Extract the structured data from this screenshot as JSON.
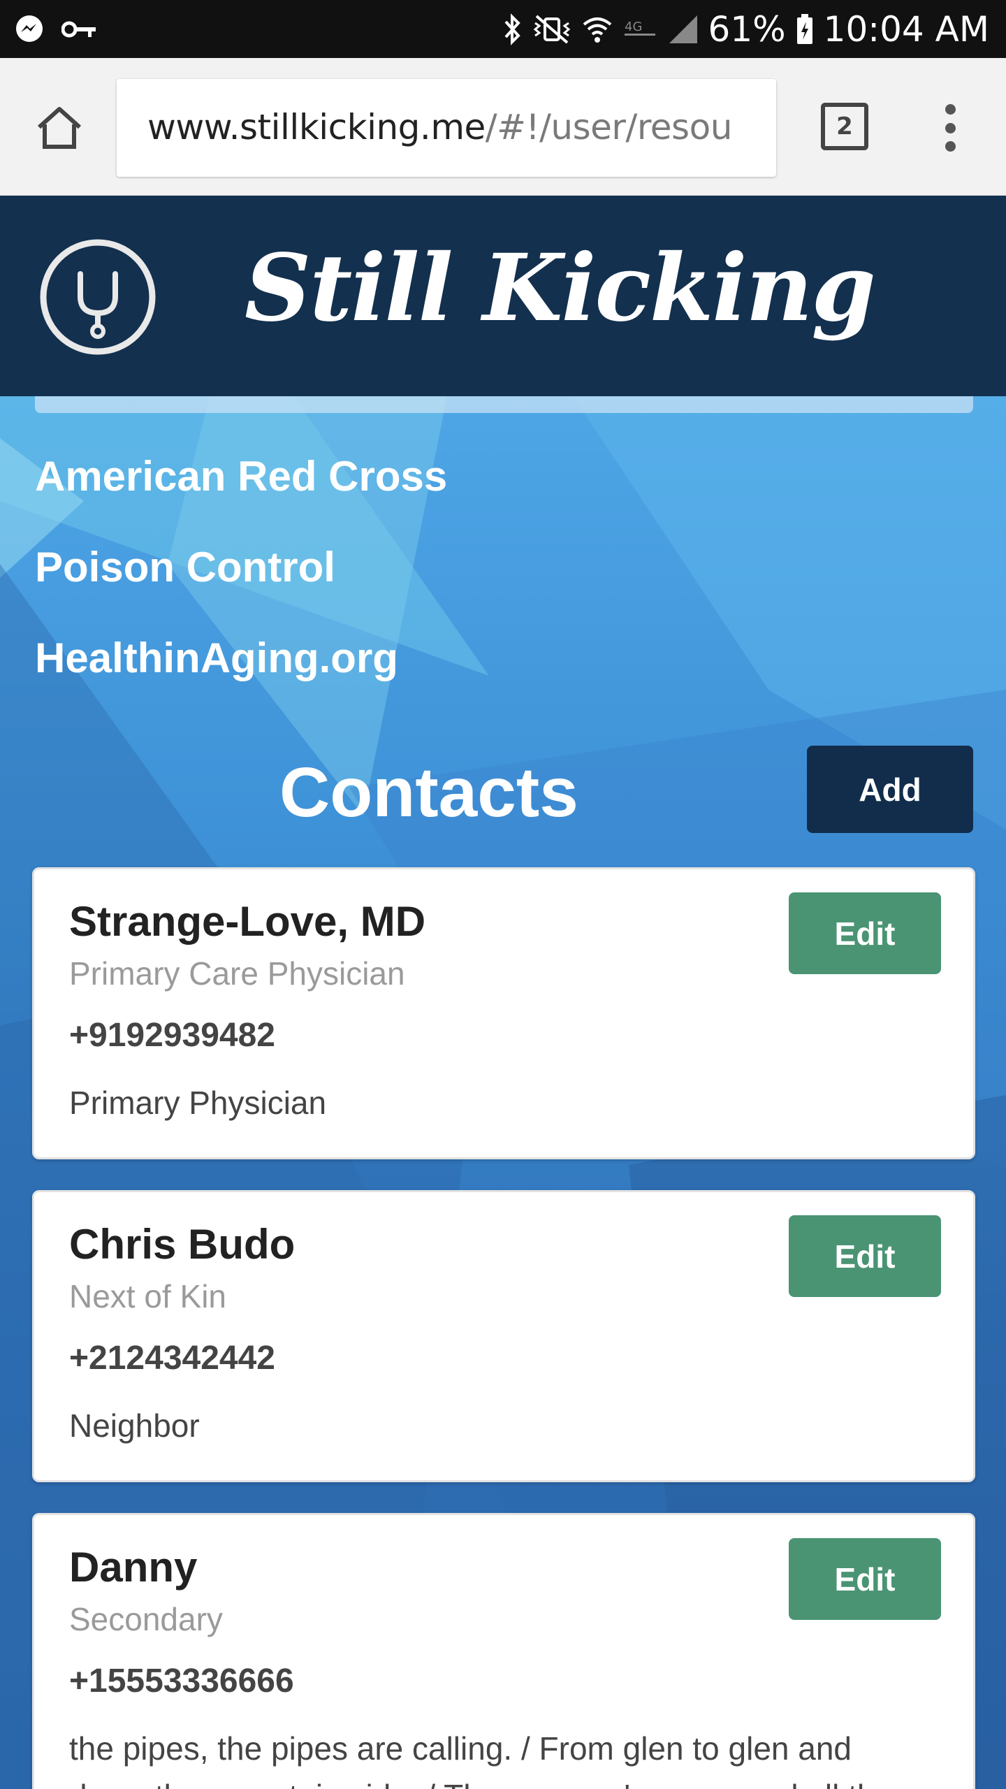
{
  "status_bar": {
    "icons": [
      "messenger-icon",
      "key-icon",
      "bluetooth-icon",
      "vibrate-icon",
      "wifi-icon",
      "lte-icon",
      "signal-icon",
      "battery-icon"
    ],
    "battery": "61%",
    "time": "10:04 AM"
  },
  "browser": {
    "url_domain": "www.stillkicking.me",
    "url_path": "/#!/user/resou",
    "tab_count": "2"
  },
  "site": {
    "brand": "Still Kicking",
    "logo_icon": "stethoscope-icon"
  },
  "resources": [
    {
      "label": "American Red Cross"
    },
    {
      "label": "Poison Control"
    },
    {
      "label": "HealthinAging.org"
    }
  ],
  "contacts": {
    "title": "Contacts",
    "add_label": "Add",
    "edit_label": "Edit",
    "items": [
      {
        "name": "Strange-Love, MD",
        "role": "Primary Care Physician",
        "phone": "+9192939482",
        "note": "Primary Physician"
      },
      {
        "name": "Chris Budo",
        "role": "Next of Kin",
        "phone": "+2124342442",
        "note": "Neighbor"
      },
      {
        "name": "Danny",
        "role": "Secondary",
        "phone": "+15553336666",
        "note": "the pipes, the pipes are calling. / From glen to glen and down the mountain side. / The summer's gone, and all the"
      }
    ]
  },
  "colors": {
    "header_bg": "#13304e",
    "add_button": "#112d4b",
    "edit_button": "#4a9473",
    "background_blue": "#3c8fd5"
  }
}
